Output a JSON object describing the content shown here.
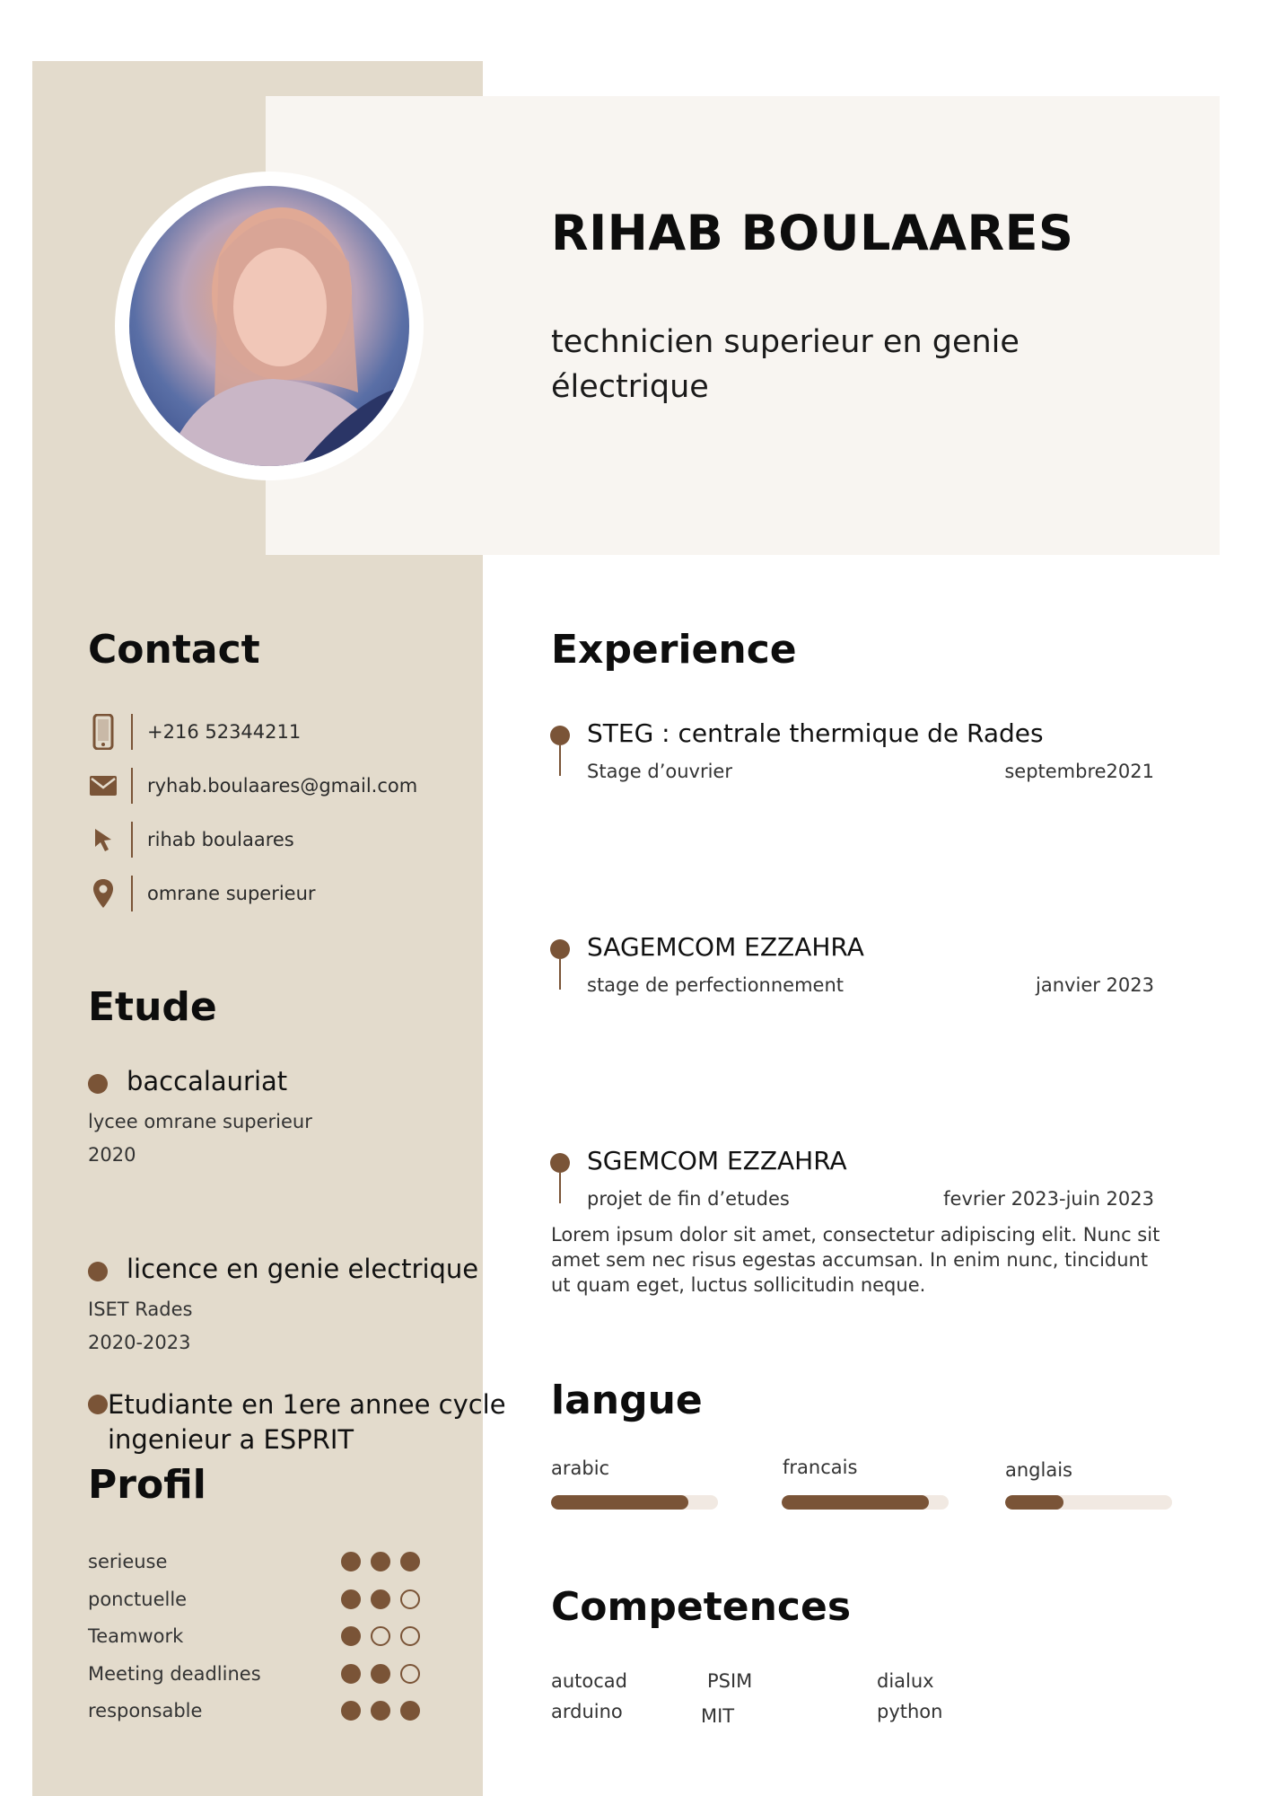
{
  "header": {
    "name": "RIHAB BOULAARES",
    "subtitle": "technicien superieur en genie électrique"
  },
  "contact": {
    "title": "Contact",
    "items": [
      {
        "icon": "phone-icon",
        "text": "+216 52344211"
      },
      {
        "icon": "mail-icon",
        "text": "ryhab.boulaares@gmail.com"
      },
      {
        "icon": "cursor-icon",
        "text": "rihab boulaares"
      },
      {
        "icon": "location-pin-icon",
        "text": "omrane superieur"
      }
    ]
  },
  "education": {
    "title": "Etude",
    "items": [
      {
        "title": "baccalauriat",
        "school": "lycee omrane superieur",
        "years": "2020"
      },
      {
        "title": "licence en genie electrique",
        "school": "ISET Rades",
        "years": "2020-2023"
      },
      {
        "title_line1": "Etudiante en 1ere annee cycle",
        "title_line2": "ingenieur a ESPRIT"
      }
    ]
  },
  "profile": {
    "title": "Profil",
    "max_level": 3,
    "items": [
      {
        "label": "serieuse",
        "level": 3
      },
      {
        "label": "ponctuelle",
        "level": 2
      },
      {
        "label": "Teamwork",
        "level": 1
      },
      {
        "label": "Meeting deadlines",
        "level": 2
      },
      {
        "label": "responsable",
        "level": 3
      }
    ]
  },
  "experience": {
    "title": "Experience",
    "items": [
      {
        "company": "STEG : centrale thermique de Rades",
        "role": "Stage d’ouvrier",
        "date": "septembre2021"
      },
      {
        "company": "SAGEMCOM EZZAHRA",
        "role": "stage de perfectionnement",
        "date": "janvier 2023"
      },
      {
        "company": "SGEMCOM EZZAHRA",
        "role": "projet de fin d’etudes",
        "date": "fevrier 2023-juin 2023",
        "description": "Lorem ipsum dolor sit amet, consectetur adipiscing elit. Nunc sit amet sem nec risus egestas accumsan. In enim nunc, tincidunt ut quam eget, luctus sollicitudin neque."
      }
    ]
  },
  "languages": {
    "title": "langue",
    "items": [
      {
        "label": "arabic",
        "level_percent": 82
      },
      {
        "label": "francais",
        "level_percent": 88
      },
      {
        "label": "anglais",
        "level_percent": 35
      }
    ]
  },
  "skills": {
    "title": "Competences",
    "items": [
      "autocad",
      "PSIM",
      "dialux",
      "arduino",
      "MIT",
      "python"
    ]
  },
  "colors": {
    "accent": "#7a5437",
    "sidebar": "#e3dbcc",
    "header_panel": "#f8f5f1",
    "bar_track": "#f1e9e2"
  }
}
